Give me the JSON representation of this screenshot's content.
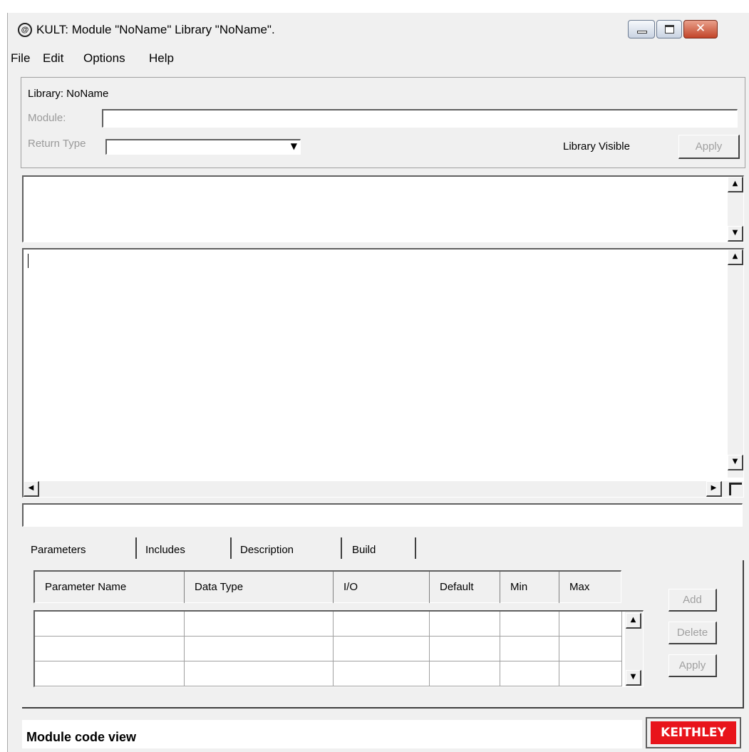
{
  "window": {
    "title": "KULT: Module \"NoName\" Library \"NoName\"."
  },
  "menu": [
    "File",
    "Edit",
    "Options",
    "Help"
  ],
  "header": {
    "library_label": "Library: NoName",
    "module_label": "Module:",
    "module_value": "",
    "return_type_label": "Return Type",
    "return_type_value": "",
    "library_visible_label": "Library Visible",
    "apply_label": "Apply"
  },
  "tabs": [
    "Parameters",
    "Includes",
    "Description",
    "Build"
  ],
  "parameters": {
    "columns": [
      "Parameter Name",
      "Data Type",
      "I/O",
      "Default",
      "Min",
      "Max"
    ],
    "rows": [
      [
        "",
        "",
        "",
        "",
        "",
        ""
      ],
      [
        "",
        "",
        "",
        "",
        "",
        ""
      ],
      [
        "",
        "",
        "",
        "",
        "",
        ""
      ]
    ]
  },
  "side_buttons": {
    "add": "Add",
    "delete": "Delete",
    "apply": "Apply"
  },
  "status": {
    "text": "Module code view"
  },
  "logo": {
    "text": "KEITHLEY",
    "color": "#e8141b"
  }
}
